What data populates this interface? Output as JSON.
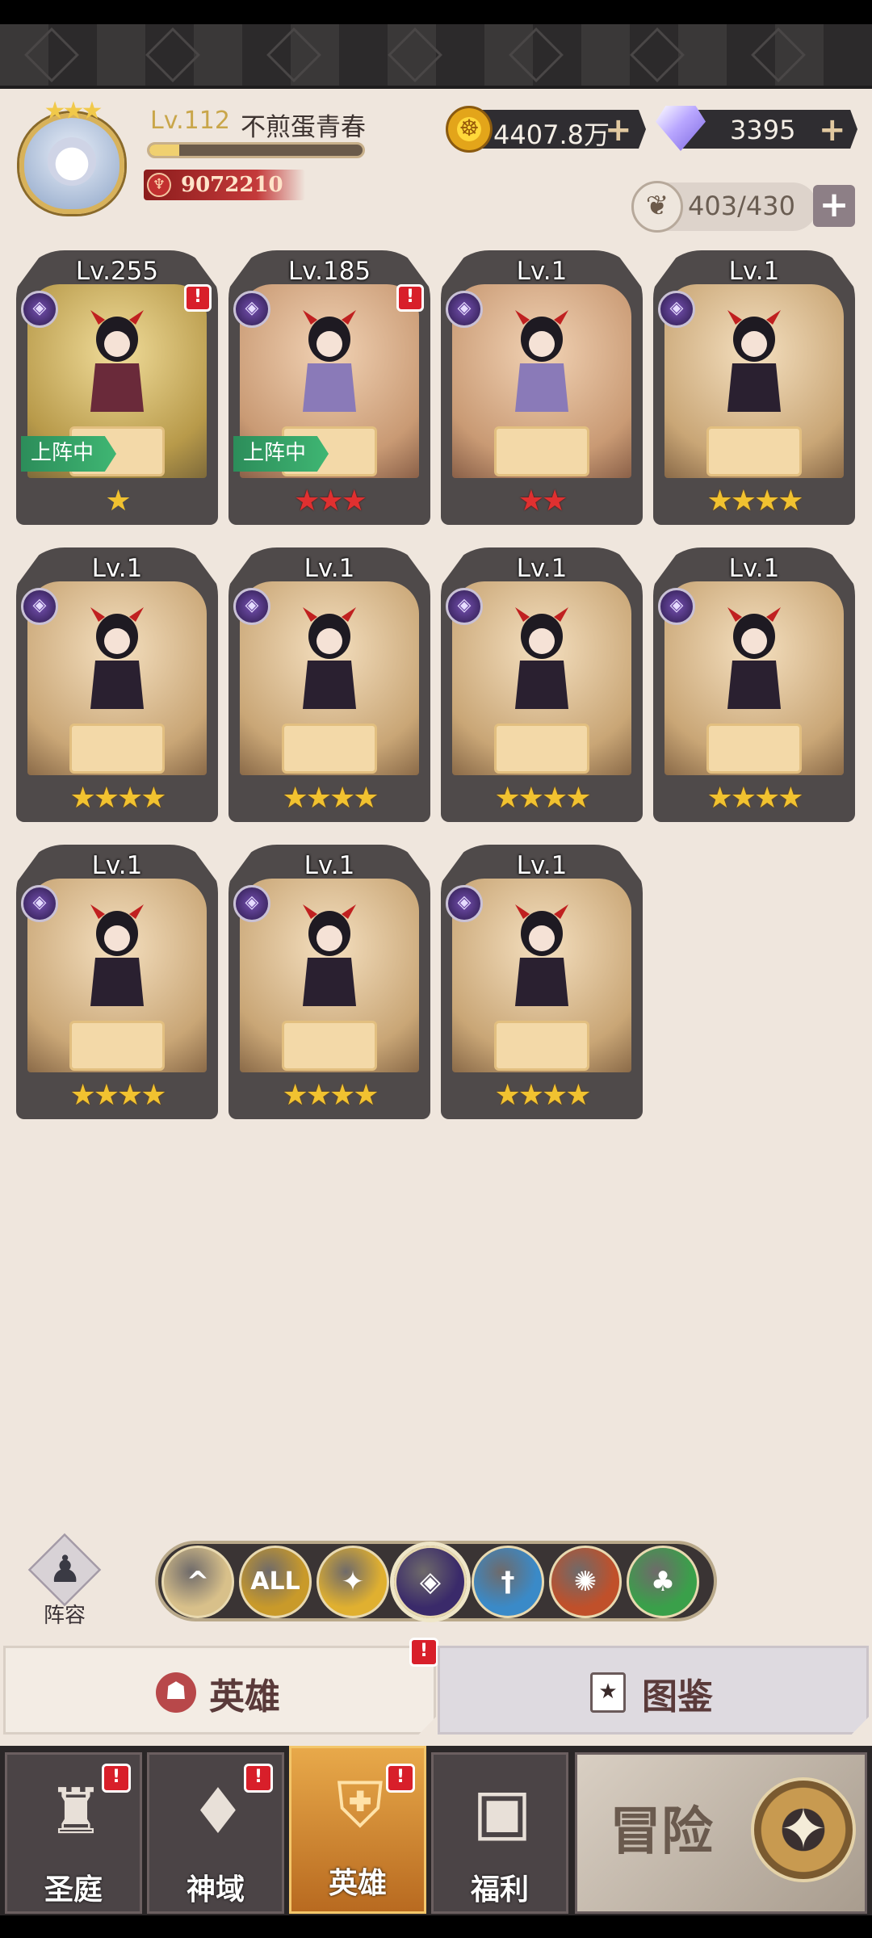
{
  "player": {
    "level": "Lv.112",
    "name": "不煎蛋青春",
    "xp_fraction": 0.14,
    "power": "9072210"
  },
  "resources": {
    "gold": "4407.8万",
    "gems": "3395",
    "capacity": "403/430"
  },
  "heroes": [
    {
      "level": "Lv.255",
      "stars": "★",
      "star_color": "wing",
      "deployed": true,
      "alert": true,
      "bg": "gold"
    },
    {
      "level": "Lv.185",
      "stars": "★★★",
      "star_color": "red",
      "deployed": true,
      "alert": true,
      "bg": "red"
    },
    {
      "level": "Lv.1",
      "stars": "★★",
      "star_color": "red",
      "deployed": false,
      "alert": false,
      "bg": "red"
    },
    {
      "level": "Lv.1",
      "stars": "★★★★",
      "star_color": "gold",
      "deployed": false,
      "alert": false,
      "bg": "brown"
    },
    {
      "level": "Lv.1",
      "stars": "★★★★",
      "star_color": "gold",
      "deployed": false,
      "alert": false,
      "bg": "brown"
    },
    {
      "level": "Lv.1",
      "stars": "★★★★",
      "star_color": "gold",
      "deployed": false,
      "alert": false,
      "bg": "brown"
    },
    {
      "level": "Lv.1",
      "stars": "★★★★",
      "star_color": "gold",
      "deployed": false,
      "alert": false,
      "bg": "brown"
    },
    {
      "level": "Lv.1",
      "stars": "★★★★",
      "star_color": "gold",
      "deployed": false,
      "alert": false,
      "bg": "brown"
    },
    {
      "level": "Lv.1",
      "stars": "★★★★",
      "star_color": "gold",
      "deployed": false,
      "alert": false,
      "bg": "brown"
    },
    {
      "level": "Lv.1",
      "stars": "★★★★",
      "star_color": "gold",
      "deployed": false,
      "alert": false,
      "bg": "brown"
    },
    {
      "level": "Lv.1",
      "stars": "★★★★",
      "star_color": "gold",
      "deployed": false,
      "alert": false,
      "bg": "brown"
    }
  ],
  "deploy_label": "上阵中",
  "lineup_label": "阵容",
  "filters": [
    {
      "icon": "chevron-up-icon",
      "label": "^",
      "color": "#d8c08a"
    },
    {
      "icon": "all-icon",
      "label": "ALL",
      "color": "#c99a2a"
    },
    {
      "icon": "light-faction-icon",
      "label": "✦",
      "color": "#e0b030"
    },
    {
      "icon": "dark-faction-icon",
      "label": "◈",
      "color": "#3a2a6a",
      "selected": true
    },
    {
      "icon": "holy-faction-icon",
      "label": "†",
      "color": "#3a8ac8"
    },
    {
      "icon": "beast-faction-icon",
      "label": "✺",
      "color": "#c0502a"
    },
    {
      "icon": "nature-faction-icon",
      "label": "♣",
      "color": "#3aa04a"
    }
  ],
  "tabs": {
    "heroes": "英雄",
    "codex": "图鉴"
  },
  "nav": [
    {
      "label": "圣庭",
      "alert": true
    },
    {
      "label": "神域",
      "alert": true
    },
    {
      "label": "英雄",
      "alert": true,
      "active": true
    },
    {
      "label": "福利",
      "alert": false
    }
  ],
  "adventure_label": "冒险",
  "alert_mark": "!"
}
